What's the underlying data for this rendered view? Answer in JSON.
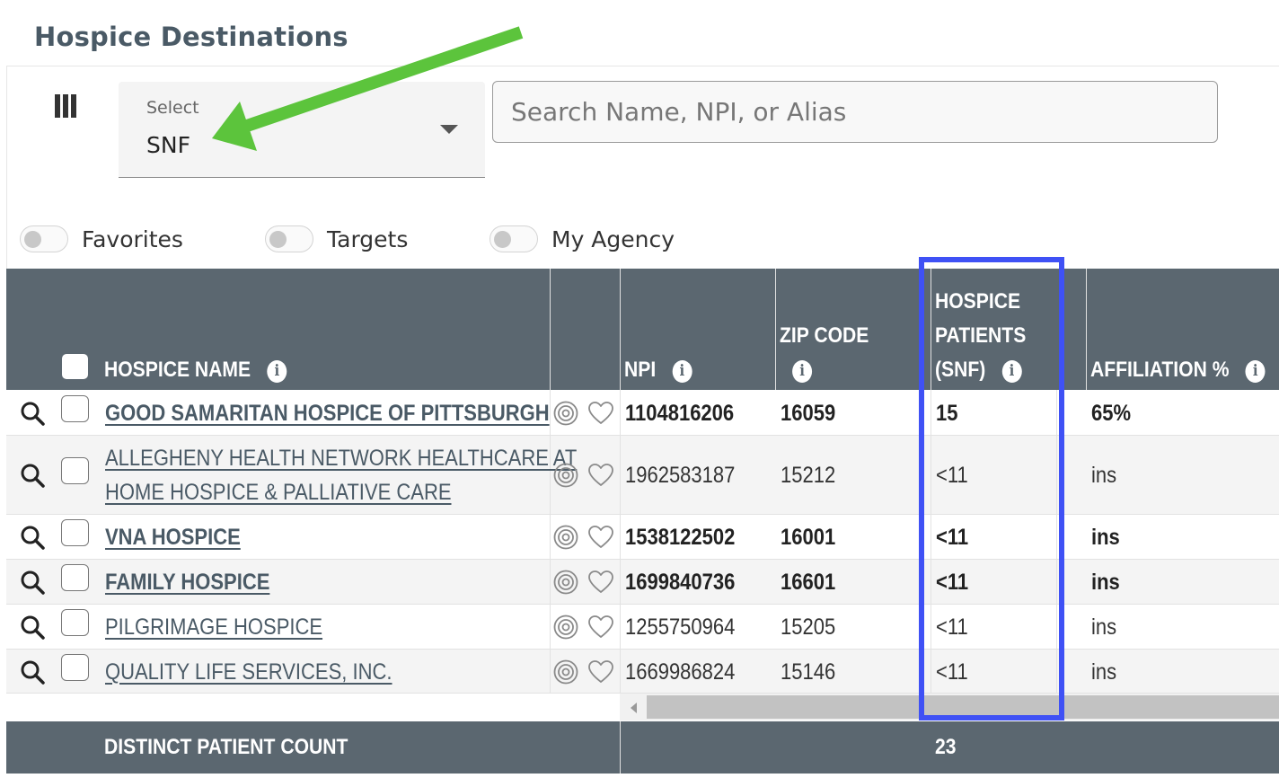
{
  "page": {
    "title": "Hospice Destinations"
  },
  "filter": {
    "select_label": "Select",
    "select_value": "SNF",
    "search_placeholder": "Search Name, NPI, or Alias"
  },
  "toggles": [
    {
      "label": "Favorites",
      "on": false
    },
    {
      "label": "Targets",
      "on": false
    },
    {
      "label": "My Agency",
      "on": false
    }
  ],
  "table": {
    "headers": {
      "name": "HOSPICE NAME",
      "npi": "NPI",
      "zip_line1": "ZIP CODE",
      "patients_line1": "HOSPICE",
      "patients_line2": "PATIENTS",
      "patients_line3": "(SNF)",
      "affiliation": "AFFILIATION %"
    },
    "rows": [
      {
        "name_line1": "GOOD SAMARITAN HOSPICE OF PITTSBURGH",
        "name_line2": "",
        "npi": "1104816206",
        "zip": "16059",
        "patients": "15",
        "affiliation": "65%",
        "bold": true
      },
      {
        "name_line1": "ALLEGHENY HEALTH NETWORK HEALTHCARE AT",
        "name_line2": "HOME HOSPICE & PALLIATIVE CARE",
        "npi": "1962583187",
        "zip": "15212",
        "patients": "<11",
        "affiliation": "ins",
        "bold": false
      },
      {
        "name_line1": "VNA HOSPICE",
        "name_line2": "",
        "npi": "1538122502",
        "zip": "16001",
        "patients": "<11",
        "affiliation": "ins",
        "bold": true
      },
      {
        "name_line1": "FAMILY HOSPICE",
        "name_line2": "",
        "npi": "1699840736",
        "zip": "16601",
        "patients": "<11",
        "affiliation": "ins",
        "bold": true
      },
      {
        "name_line1": "PILGRIMAGE HOSPICE",
        "name_line2": "",
        "npi": "1255750964",
        "zip": "15205",
        "patients": "<11",
        "affiliation": "ins",
        "bold": false
      },
      {
        "name_line1": "QUALITY LIFE SERVICES, INC.",
        "name_line2": "",
        "npi": "1669986824",
        "zip": "15146",
        "patients": "<11",
        "affiliation": "ins",
        "bold": false
      }
    ]
  },
  "footer": {
    "label": "DISTINCT PATIENT COUNT",
    "value": "23"
  },
  "icons": {
    "columns": "columns-icon",
    "info": "info-icon",
    "search": "search-icon",
    "target": "target-icon",
    "heart": "heart-icon",
    "caret": "caret-down-icon"
  },
  "colors": {
    "header_bg": "#5b6770",
    "link": "#4a5a66",
    "annotation_arrow": "#5cc43c",
    "annotation_box": "#3f51f5"
  }
}
